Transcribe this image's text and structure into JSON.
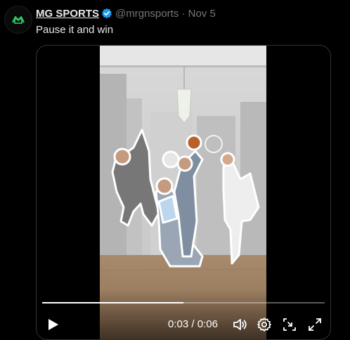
{
  "tweet": {
    "author_name": "MG SPORTS",
    "handle": "@mrgnsports",
    "separator": "·",
    "date": "Nov 5",
    "text": "Pause it and win"
  },
  "video": {
    "current_time": "0:03",
    "time_separator": " / ",
    "duration": "0:06",
    "progress": 0.5
  },
  "icons": {
    "avatar": "mg-sports-logo-icon",
    "verified": "verified-badge-icon",
    "play": "play-icon",
    "volume": "volume-icon",
    "settings": "gear-icon",
    "pip": "picture-in-picture-icon",
    "fullscreen": "fullscreen-icon"
  },
  "colors": {
    "verified": "#1d9bf0",
    "brand_green": "#2fd16b",
    "muted_text": "#71767b"
  }
}
